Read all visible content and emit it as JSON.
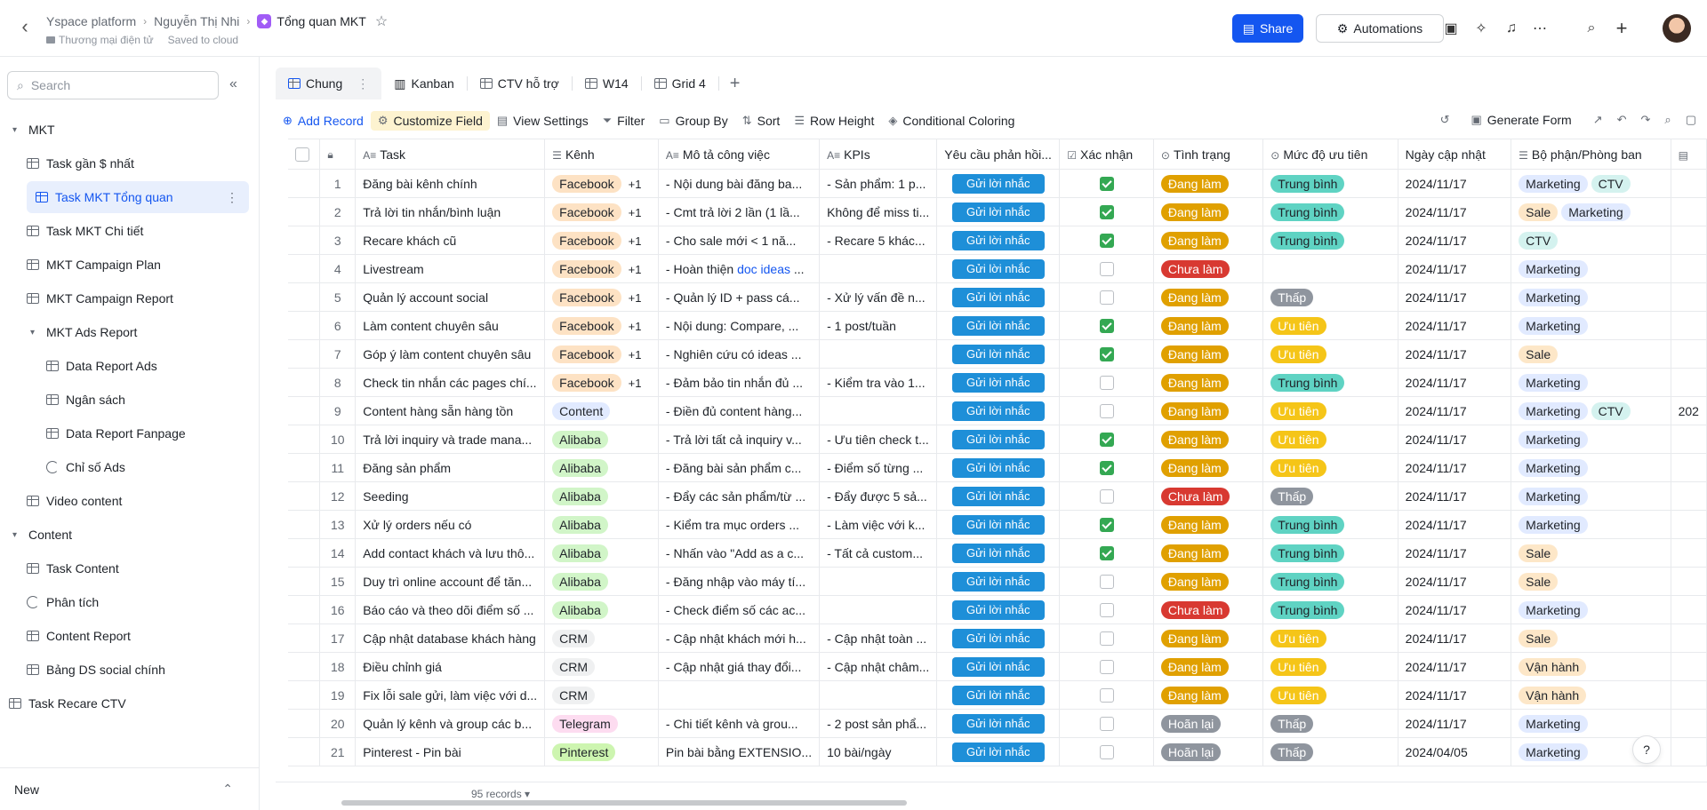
{
  "topbar": {
    "breadcrumbs": [
      "Yspace platform",
      "Nguyễn Thị Nhi",
      "Tổng quan MKT"
    ],
    "folder": "Thương mại điện tử",
    "saved": "Saved to cloud",
    "share_label": "Share",
    "automations_label": "Automations"
  },
  "sidebar": {
    "search_placeholder": "Search",
    "footer_label": "New",
    "items": [
      {
        "label": "MKT",
        "type": "folder"
      },
      {
        "label": "Task gần $ nhất",
        "type": "table"
      },
      {
        "label": "Task MKT Tổng quan",
        "type": "table",
        "active": true
      },
      {
        "label": "Task MKT Chi tiết",
        "type": "table"
      },
      {
        "label": "MKT Campaign Plan",
        "type": "table"
      },
      {
        "label": "MKT Campaign Report",
        "type": "table"
      },
      {
        "label": "MKT Ads Report",
        "type": "folder"
      },
      {
        "label": "Data Report Ads",
        "type": "table"
      },
      {
        "label": "Ngân sách",
        "type": "table"
      },
      {
        "label": "Data Report Fanpage",
        "type": "table"
      },
      {
        "label": "Chỉ số Ads",
        "type": "dashboard"
      },
      {
        "label": "Video content",
        "type": "table"
      },
      {
        "label": "Content",
        "type": "folder"
      },
      {
        "label": "Task Content",
        "type": "table"
      },
      {
        "label": "Phân tích",
        "type": "dashboard"
      },
      {
        "label": "Content Report",
        "type": "table"
      },
      {
        "label": "Bảng DS social chính",
        "type": "table"
      },
      {
        "label": "Task Recare CTV",
        "type": "table"
      }
    ]
  },
  "tabs": [
    "Chung",
    "Kanban",
    "CTV hỗ trợ",
    "W14",
    "Grid 4"
  ],
  "toolbar": {
    "add_record": "Add Record",
    "customize_field": "Customize Field",
    "view_settings": "View Settings",
    "filter": "Filter",
    "group_by": "Group By",
    "sort": "Sort",
    "row_height": "Row Height",
    "conditional_coloring": "Conditional Coloring",
    "generate_form": "Generate Form"
  },
  "columns": [
    "Task",
    "Kênh",
    "Mô tả công việc",
    "KPIs",
    "Yêu cầu phản hồi...",
    "Xác nhận",
    "Tình trạng",
    "Mức độ ưu tiên",
    "Ngày cập nhật",
    "Bộ phận/Phòng ban"
  ],
  "remind_label": "Gửi lời nhắc",
  "records_count": "95 records",
  "rows": [
    {
      "n": "1",
      "task": "Đăng bài kênh chính",
      "kenh": "Facebook",
      "kenh_plus": "+1",
      "mota": "- Nội dung bài đăng ba...",
      "kpi": "- Sản phẩm: 1 p...",
      "ok": true,
      "status": "Đang làm",
      "prio": "Trung bình",
      "date": "2024/11/17",
      "dept": [
        "Marketing",
        "CTV"
      ]
    },
    {
      "n": "2",
      "task": "Trả lời tin nhắn/bình luận",
      "kenh": "Facebook",
      "kenh_plus": "+1",
      "mota": "- Cmt trả lời 2 lần (1 lầ...",
      "kpi": "Không để miss ti...",
      "ok": true,
      "status": "Đang làm",
      "prio": "Trung bình",
      "date": "2024/11/17",
      "dept": [
        "Sale",
        "Marketing"
      ]
    },
    {
      "n": "3",
      "task": "Recare khách cũ",
      "kenh": "Facebook",
      "kenh_plus": "+1",
      "mota": "- Cho sale mới < 1 nă...",
      "kpi": "- Recare 5 khác...",
      "ok": true,
      "status": "Đang làm",
      "prio": "Trung bình",
      "date": "2024/11/17",
      "dept": [
        "CTV"
      ]
    },
    {
      "n": "4",
      "task": "Livestream",
      "kenh": "Facebook",
      "kenh_plus": "+1",
      "mota": "- Hoàn thiện ",
      "mota_link": "doc ideas",
      "mota_tail": " ...",
      "kpi": "",
      "ok": false,
      "status": "Chưa làm",
      "prio": "",
      "date": "2024/11/17",
      "dept": [
        "Marketing"
      ]
    },
    {
      "n": "5",
      "task": "Quản lý account social",
      "kenh": "Facebook",
      "kenh_plus": "+1",
      "mota": "- Quản lý ID + pass cá...",
      "kpi": "- Xử lý vấn đề n...",
      "ok": false,
      "status": "Đang làm",
      "prio": "Thấp",
      "date": "2024/11/17",
      "dept": [
        "Marketing"
      ]
    },
    {
      "n": "6",
      "task": "Làm content chuyên sâu",
      "kenh": "Facebook",
      "kenh_plus": "+1",
      "mota": "- Nội dung: Compare, ...",
      "kpi": "- 1 post/tuần",
      "ok": true,
      "status": "Đang làm",
      "prio": "Ưu tiên",
      "date": "2024/11/17",
      "dept": [
        "Marketing"
      ]
    },
    {
      "n": "7",
      "task": "Góp ý làm content chuyên sâu",
      "kenh": "Facebook",
      "kenh_plus": "+1",
      "mota": "- Nghiên cứu có ideas ...",
      "kpi": "",
      "ok": true,
      "status": "Đang làm",
      "prio": "Ưu tiên",
      "date": "2024/11/17",
      "dept": [
        "Sale"
      ]
    },
    {
      "n": "8",
      "task": "Check tin nhắn các pages chí...",
      "kenh": "Facebook",
      "kenh_plus": "+1",
      "mota": "- Đảm bảo tin nhắn đủ ...",
      "kpi": "- Kiểm tra vào 1...",
      "ok": false,
      "status": "Đang làm",
      "prio": "Trung bình",
      "date": "2024/11/17",
      "dept": [
        "Marketing"
      ]
    },
    {
      "n": "9",
      "task": "Content hàng sẵn hàng tồn",
      "kenh": "Content",
      "kenh_plus": "",
      "mota": "- Điền đủ content hàng...",
      "kpi": "",
      "ok": false,
      "status": "Đang làm",
      "prio": "Ưu tiên",
      "date": "2024/11/17",
      "dept": [
        "Marketing",
        "CTV"
      ],
      "extra": "202"
    },
    {
      "n": "10",
      "task": "Trả lời inquiry và trade mana...",
      "kenh": "Alibaba",
      "kenh_plus": "",
      "mota": "- Trả lời tất cả inquiry v...",
      "kpi": "- Ưu tiên check t...",
      "ok": true,
      "status": "Đang làm",
      "prio": "Ưu tiên",
      "date": "2024/11/17",
      "dept": [
        "Marketing"
      ]
    },
    {
      "n": "11",
      "task": "Đăng sản phẩm",
      "kenh": "Alibaba",
      "kenh_plus": "",
      "mota": "- Đăng bài sản phẩm c...",
      "kpi": "- Điểm số từng ...",
      "ok": true,
      "status": "Đang làm",
      "prio": "Ưu tiên",
      "date": "2024/11/17",
      "dept": [
        "Marketing"
      ]
    },
    {
      "n": "12",
      "task": "Seeding",
      "kenh": "Alibaba",
      "kenh_plus": "",
      "mota": "- Đẩy các sản phẩm/từ ...",
      "kpi": "- Đẩy được 5 sả...",
      "ok": false,
      "status": "Chưa làm",
      "prio": "Thấp",
      "date": "2024/11/17",
      "dept": [
        "Marketing"
      ]
    },
    {
      "n": "13",
      "task": "Xử lý orders nếu có",
      "kenh": "Alibaba",
      "kenh_plus": "",
      "mota": "- Kiểm tra mục orders ...",
      "kpi": "- Làm việc với k...",
      "ok": true,
      "status": "Đang làm",
      "prio": "Trung bình",
      "date": "2024/11/17",
      "dept": [
        "Marketing"
      ]
    },
    {
      "n": "14",
      "task": "Add contact khách và lưu thô...",
      "kenh": "Alibaba",
      "kenh_plus": "",
      "mota": "- Nhấn vào \"Add as a c...",
      "kpi": "- Tất cả custom...",
      "ok": true,
      "status": "Đang làm",
      "prio": "Trung bình",
      "date": "2024/11/17",
      "dept": [
        "Sale"
      ]
    },
    {
      "n": "15",
      "task": "Duy trì online account để tăn...",
      "kenh": "Alibaba",
      "kenh_plus": "",
      "mota": "- Đăng nhập vào máy tí...",
      "kpi": "",
      "ok": false,
      "status": "Đang làm",
      "prio": "Trung bình",
      "date": "2024/11/17",
      "dept": [
        "Sale"
      ]
    },
    {
      "n": "16",
      "task": "Báo cáo và theo dõi điểm số ...",
      "kenh": "Alibaba",
      "kenh_plus": "",
      "mota": "- Check điểm số các ac...",
      "kpi": "",
      "ok": false,
      "status": "Chưa làm",
      "prio": "Trung bình",
      "date": "2024/11/17",
      "dept": [
        "Marketing"
      ]
    },
    {
      "n": "17",
      "task": "Cập nhật database khách hàng",
      "kenh": "CRM",
      "kenh_plus": "",
      "mota": "- Cập nhật khách mới h...",
      "kpi": "- Cập nhật toàn ...",
      "ok": false,
      "status": "Đang làm",
      "prio": "Ưu tiên",
      "date": "2024/11/17",
      "dept": [
        "Sale"
      ]
    },
    {
      "n": "18",
      "task": "Điều chỉnh giá",
      "kenh": "CRM",
      "kenh_plus": "",
      "mota": "- Cập nhật giá thay đổi...",
      "kpi": "- Cập nhật châm...",
      "ok": false,
      "status": "Đang làm",
      "prio": "Ưu tiên",
      "date": "2024/11/17",
      "dept": [
        "Vận hành"
      ]
    },
    {
      "n": "19",
      "task": "Fix lỗi sale gửi, làm việc với d...",
      "kenh": "CRM",
      "kenh_plus": "",
      "mota": "",
      "kpi": "",
      "ok": false,
      "status": "Đang làm",
      "prio": "Ưu tiên",
      "date": "2024/11/17",
      "dept": [
        "Vận hành"
      ]
    },
    {
      "n": "20",
      "task": "Quản lý kênh và group các b...",
      "kenh": "Telegram",
      "kenh_plus": "",
      "mota": "- Chi tiết kênh và grou...",
      "kpi": "- 2 post sản phẩ...",
      "ok": false,
      "status": "Hoãn lại",
      "prio": "Thấp",
      "date": "2024/11/17",
      "dept": [
        "Marketing"
      ]
    },
    {
      "n": "21",
      "task": "Pinterest - Pin bài",
      "kenh": "Pinterest",
      "kenh_plus": "",
      "mota": "Pin bài bằng EXTENSIO...",
      "kpi": "10 bài/ngày",
      "ok": false,
      "status": "Hoãn lại",
      "prio": "Thấp",
      "date": "2024/04/05",
      "dept": [
        "Marketing"
      ]
    }
  ],
  "colors": {
    "accent": "#1456f0",
    "remind_button": "#1e8fd8",
    "check_on": "#34a853",
    "status": {
      "Đang làm": "#e0a000",
      "Chưa làm": "#d83931",
      "Hoãn lại": "#8f959e"
    },
    "priority": {
      "Trung bình": "#5fd3c3",
      "Ưu tiên": "#f5c518",
      "Thấp": "#8f959e"
    },
    "channel": {
      "Facebook": "#fde2c4",
      "Content": "#e1eaff",
      "Alibaba": "#d1f5c8",
      "CRM": "#eff0f1",
      "Telegram": "#fddcf0",
      "Pinterest": "#cdf5b0"
    },
    "dept": {
      "Marketing": "#e1eaff",
      "CTV": "#d4f2ef",
      "Sale": "#fde7c8",
      "Vận hành": "#fde7c8"
    }
  }
}
